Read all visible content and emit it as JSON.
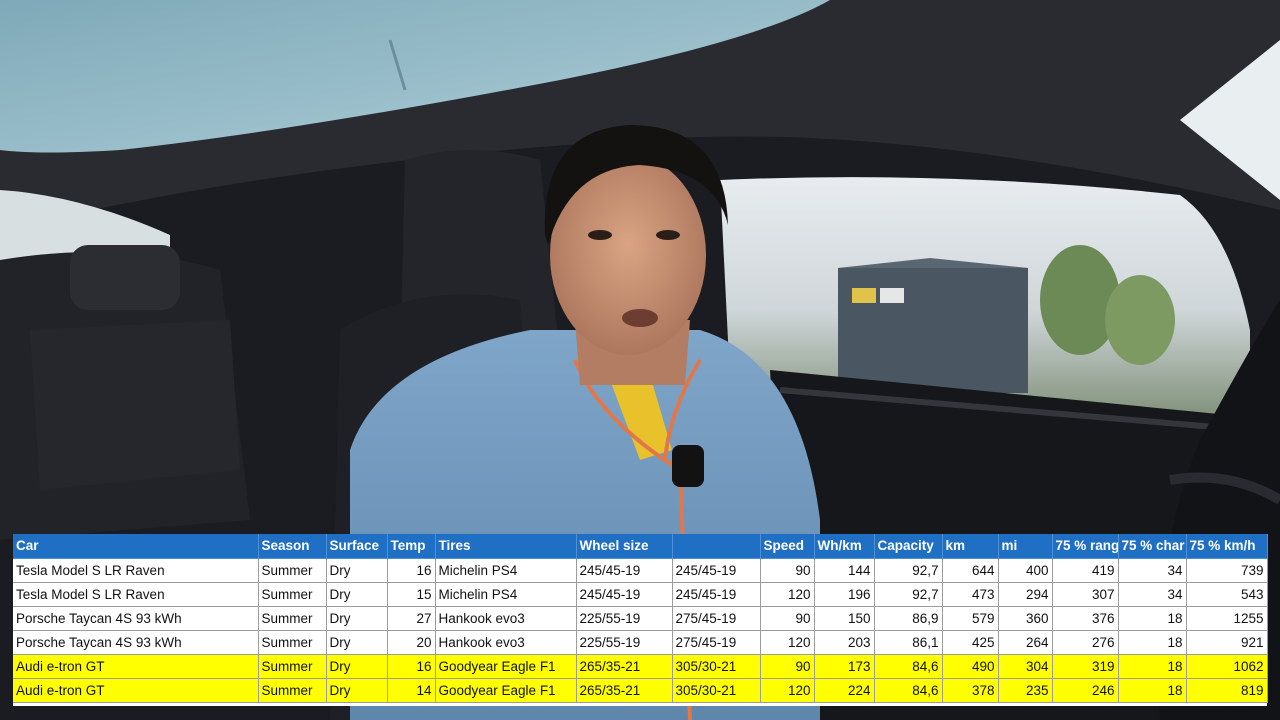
{
  "video_frame": {
    "description_icon": "car-interior-photo"
  },
  "table": {
    "columns": [
      "Car",
      "Season",
      "Surface",
      "Temp",
      "Tires",
      "Wheel size",
      "",
      "Speed",
      "Wh/km",
      "Capacity",
      "km",
      "mi",
      "75 % rang",
      "75 % char",
      "75 % km/h"
    ],
    "rows": [
      {
        "highlight": false,
        "cells": [
          "Tesla Model S LR Raven",
          "Summer",
          "Dry",
          "16",
          "Michelin PS4",
          "245/45-19",
          "245/45-19",
          "90",
          "144",
          "92,7",
          "644",
          "400",
          "419",
          "34",
          "739"
        ]
      },
      {
        "highlight": false,
        "cells": [
          "Tesla Model S LR Raven",
          "Summer",
          "Dry",
          "15",
          "Michelin PS4",
          "245/45-19",
          "245/45-19",
          "120",
          "196",
          "92,7",
          "473",
          "294",
          "307",
          "34",
          "543"
        ]
      },
      {
        "highlight": false,
        "cells": [
          "Porsche Taycan 4S 93 kWh",
          "Summer",
          "Dry",
          "27",
          "Hankook evo3",
          "225/55-19",
          "275/45-19",
          "90",
          "150",
          "86,9",
          "579",
          "360",
          "376",
          "18",
          "1255"
        ]
      },
      {
        "highlight": false,
        "cells": [
          "Porsche Taycan 4S 93 kWh",
          "Summer",
          "Dry",
          "20",
          "Hankook evo3",
          "225/55-19",
          "275/45-19",
          "120",
          "203",
          "86,1",
          "425",
          "264",
          "276",
          "18",
          "921"
        ]
      },
      {
        "highlight": true,
        "cells": [
          "Audi e-tron GT",
          "Summer",
          "Dry",
          "16",
          "Goodyear Eagle F1",
          "265/35-21",
          "305/30-21",
          "90",
          "173",
          "84,6",
          "490",
          "304",
          "319",
          "18",
          "1062"
        ]
      },
      {
        "highlight": true,
        "cells": [
          "Audi e-tron GT",
          "Summer",
          "Dry",
          "14",
          "Goodyear Eagle F1",
          "265/35-21",
          "305/30-21",
          "120",
          "224",
          "84,6",
          "378",
          "235",
          "246",
          "18",
          "819"
        ]
      }
    ],
    "colors": {
      "header": "#1f6fc4",
      "highlight": "#ffff00"
    }
  }
}
